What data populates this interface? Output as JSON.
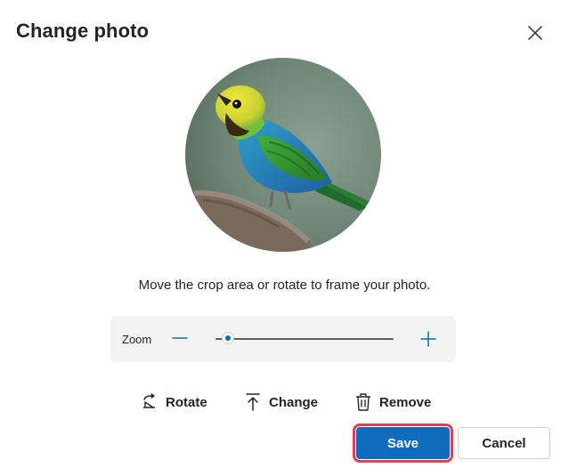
{
  "dialog": {
    "title": "Change photo",
    "close_icon": "close-icon",
    "photo_subject": "bird-photo",
    "instruction": "Move the crop area or rotate to frame your photo.",
    "zoom": {
      "label": "Zoom",
      "minus_icon": "minus-icon",
      "plus_icon": "plus-icon",
      "level": 0.03
    },
    "actions": {
      "rotate": "Rotate",
      "change": "Change",
      "remove": "Remove"
    },
    "buttons": {
      "save": "Save",
      "cancel": "Cancel"
    },
    "colors": {
      "accent": "#0f6cbd",
      "highlight": "#e0404e"
    }
  }
}
